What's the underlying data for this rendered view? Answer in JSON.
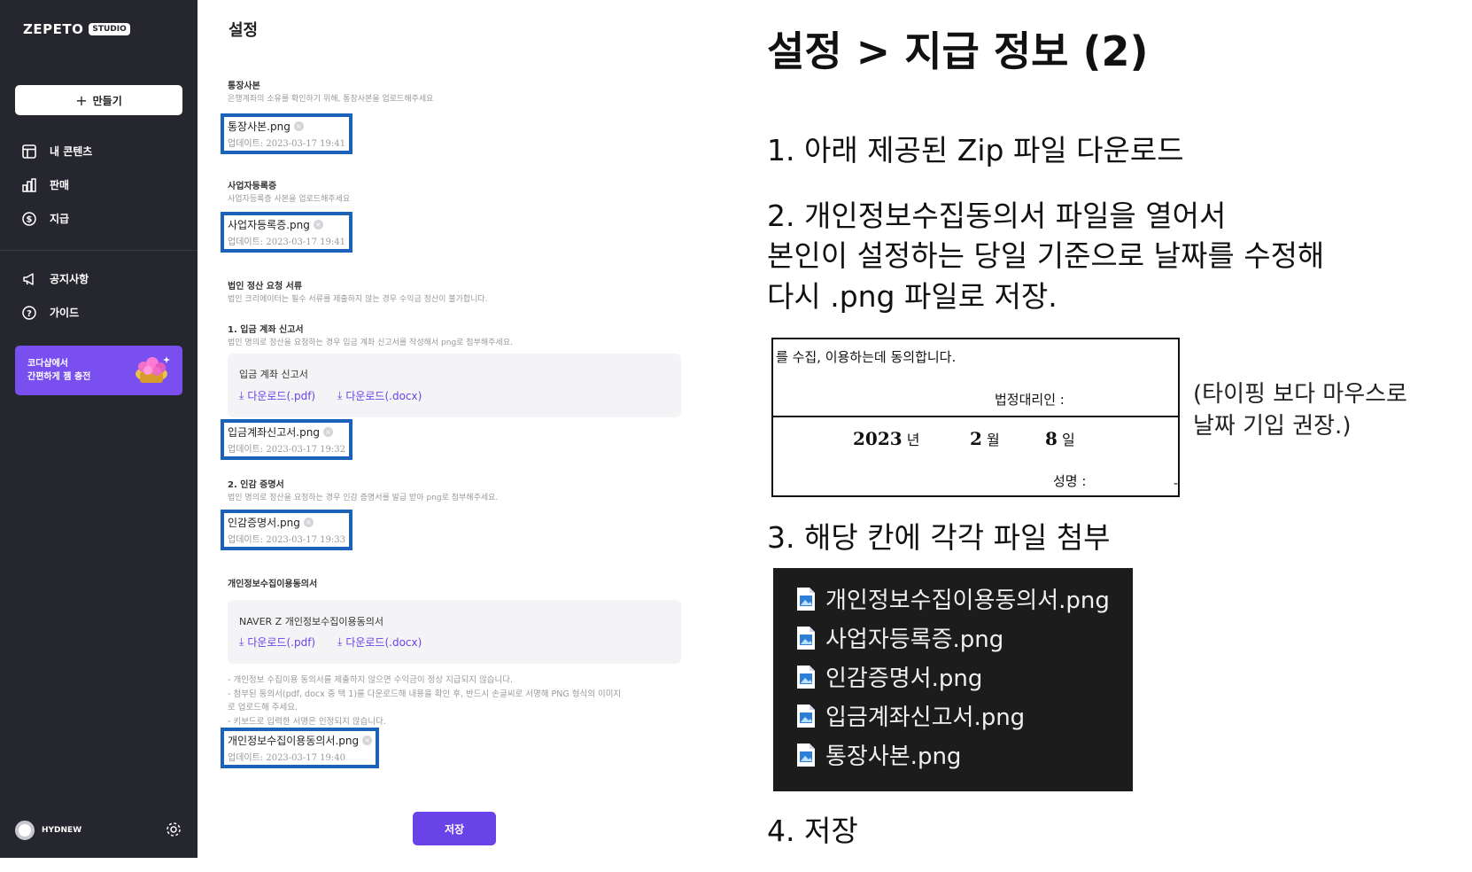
{
  "sidebar": {
    "logo": "ZEPETO",
    "logo_badge": "STUDIO",
    "create_label": "만들기",
    "nav": [
      {
        "label": "내 콘텐츠",
        "icon": "layout-icon"
      },
      {
        "label": "판매",
        "icon": "bar-chart-icon"
      },
      {
        "label": "지급",
        "icon": "dollar-circle-icon"
      },
      {
        "label": "공지사항",
        "icon": "megaphone-icon"
      },
      {
        "label": "가이드",
        "icon": "help-circle-icon"
      }
    ],
    "promo": "코다샵에서\n간편하게 젬 충전",
    "username": "HYDNEW"
  },
  "settings": {
    "title": "설정",
    "bankbook": {
      "title": "통장사본",
      "desc": "은행계좌의 소유를 확인하기 위해, 통장사본을 업로드해주세요",
      "file": "통장사본.png",
      "date": "업데이트: 2023-03-17 19:41"
    },
    "business": {
      "title": "사업자등록증",
      "desc": "사업자등록증 사본을 업로드해주세요",
      "file": "사업자등록증.png",
      "date": "업데이트: 2023-03-17 19:41"
    },
    "corp": {
      "title": "법인 정산 요청 서류",
      "desc": "법인 크리에이터는 필수 서류를 제출하지 않는 경우 수익금 정산이 불가합니다."
    },
    "deposit": {
      "title": "1. 입금 계좌 신고서",
      "desc": "법인 명의로 정산을 요청하는 경우 입금 계좌 신고서를 작성해서 png로 첨부해주세요.",
      "box_title": "입금 계좌 신고서",
      "dl_pdf": "다운로드(.pdf)",
      "dl_docx": "다운로드(.docx)",
      "file": "입금계좌신고서.png",
      "date": "업데이트: 2023-03-17 19:32"
    },
    "seal": {
      "title": "2. 인감 증명서",
      "desc": "법인 명의로 정산을 요청하는 경우 인감 증명서를 발급 받아 png로 첨부해주세요.",
      "file": "인감증명서.png",
      "date": "업데이트: 2023-03-17 19:33"
    },
    "privacy": {
      "title": "개인정보수집이용동의서",
      "box_title": "NAVER Z 개인정보수집이용동의서",
      "dl_pdf": "다운로드(.pdf)",
      "dl_docx": "다운로드(.docx)",
      "notes": "- 개인정보 수집이용 동의서를 제출하지 않으면 수익금이 정상 지급되지 않습니다.\n- 첨부된 동의서(pdf, docx 중 택 1)를 다운로드해 내용을 확인 후, 반드시 손글씨로 서명해 PNG 형식의 이미지\n   로 업로드해 주세요.\n- 키보드로 입력한 서명은 인정되지 않습니다.",
      "file": "개인정보수집이용동의서.png",
      "date": "업데이트: 2023-03-17 19:40"
    },
    "save_label": "저장"
  },
  "instructions": {
    "title": "설정 > 지급 정보 (2)",
    "step1": "1. 아래 제공된 Zip 파일 다운로드",
    "step2_line1": "2. 개인정보수집동의서 파일을 열어서",
    "step2_line2": "본인이 설정하는 당일 기준으로 날짜를 수정해",
    "step2_line3": "다시 .png 파일로 저장.",
    "form": {
      "consent": "를 수집, 이용하는데 동의합니다.",
      "guardian": "법정대리인 :",
      "year_value": "2023",
      "year_label": "년",
      "month_value": "2",
      "month_label": "월",
      "day_value": "8",
      "day_label": "일",
      "sign": "성명 :",
      "edge": "‐"
    },
    "side_note": "(타이핑 보다 마우스로\n날짜 기입 권장.)",
    "step3": "3. 해당 칸에 각각 파일 첨부",
    "files": [
      "개인정보수집이용동의서.png",
      "사업자등록증.png",
      "인감증명서.png",
      "입금계좌신고서.png",
      "통장사본.png"
    ],
    "step4": "4. 저장"
  },
  "colors": {
    "sidebar_bg": "#26262e",
    "accent": "#6a43e8",
    "highlight_border": "#1a63b8",
    "explorer_bg": "#1c1c1c"
  }
}
